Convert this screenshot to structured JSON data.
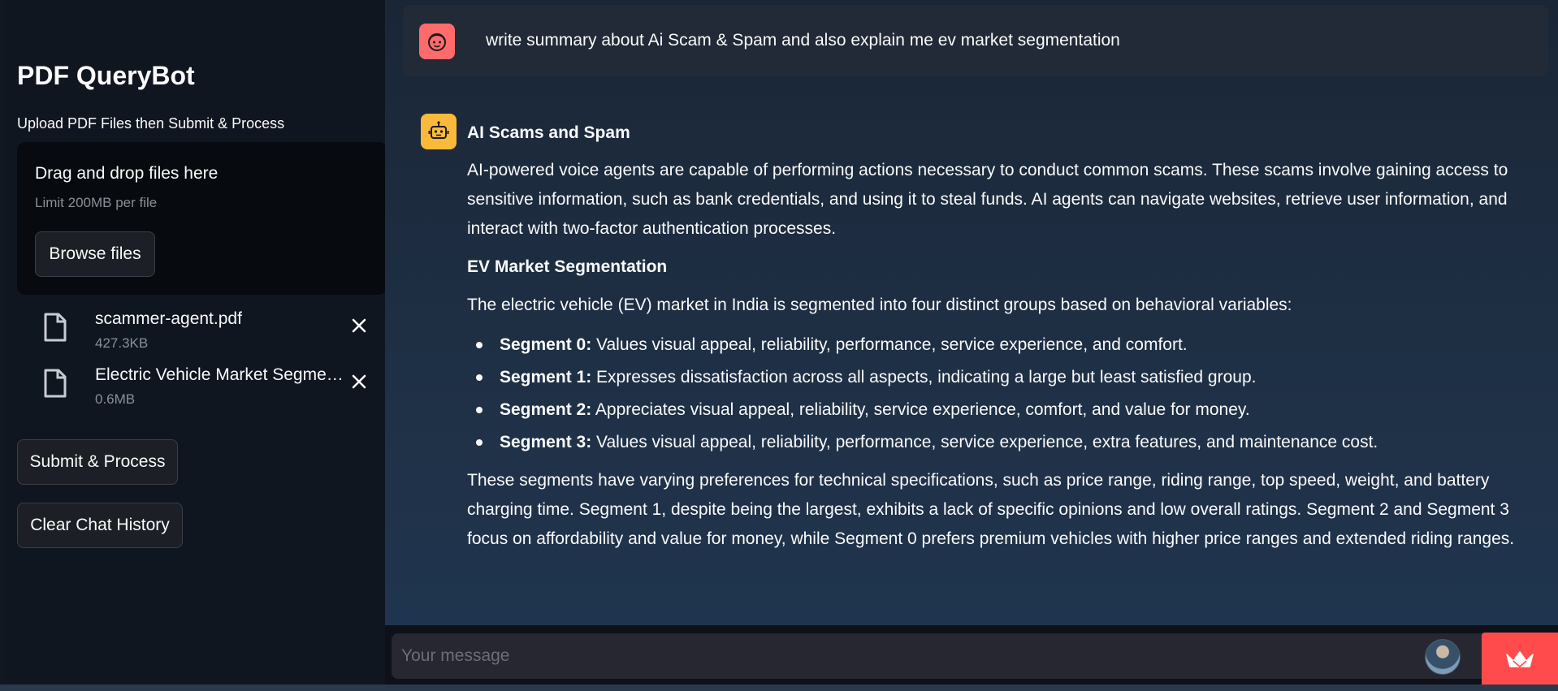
{
  "sidebar": {
    "title": "PDF QueryBot",
    "subtitle": "Upload PDF Files then Submit & Process",
    "dropzone": {
      "title": "Drag and drop files here",
      "limit": "Limit 200MB per file",
      "browse_label": "Browse files"
    },
    "files": [
      {
        "name": "scammer-agent.pdf",
        "size": "427.3KB"
      },
      {
        "name": "Electric Vehicle Market Segmentation.pdf",
        "size": "0.6MB"
      }
    ],
    "submit_label": "Submit & Process",
    "clear_label": "Clear Chat History"
  },
  "chat": {
    "user_message": "write summary about Ai Scam & Spam and also explain me ev market segmentation",
    "reply": {
      "heading1": "AI Scams and Spam",
      "para1": "AI-powered voice agents are capable of performing actions necessary to conduct common scams. These scams involve gaining access to sensitive information, such as bank credentials, and using it to steal funds. AI agents can navigate websites, retrieve user information, and interact with two-factor authentication processes.",
      "heading2": "EV Market Segmentation",
      "para2": "The electric vehicle (EV) market in India is segmented into four distinct groups based on behavioral variables:",
      "segments": [
        {
          "label": "Segment 0:",
          "text": " Values visual appeal, reliability, performance, service experience, and comfort."
        },
        {
          "label": "Segment 1:",
          "text": " Expresses dissatisfaction across all aspects, indicating a large but least satisfied group."
        },
        {
          "label": "Segment 2:",
          "text": " Appreciates visual appeal, reliability, service experience, comfort, and value for money."
        },
        {
          "label": "Segment 3:",
          "text": " Values visual appeal, reliability, performance, service experience, extra features, and maintenance cost."
        }
      ],
      "para3": "These segments have varying preferences for technical specifications, such as price range, riding range, top speed, weight, and battery charging time. Segment 1, despite being the largest, exhibits a lack of specific opinions and low overall ratings. Segment 2 and Segment 3 focus on affordability and value for money, while Segment 0 prefers premium vehicles with higher price ranges and extended riding ranges."
    },
    "input_placeholder": "Your message"
  },
  "colors": {
    "accent": "#ff4b4b",
    "user_avatar": "#ff6b6b",
    "bot_avatar": "#f9b93a"
  },
  "icons": {
    "user_avatar": "face-icon",
    "bot_avatar": "robot-icon",
    "file": "file-icon",
    "remove": "close-icon",
    "send": "crown-icon"
  }
}
